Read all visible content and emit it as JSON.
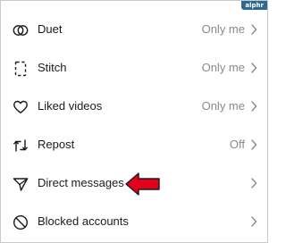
{
  "watermark": "alphr",
  "colors": {
    "accent_arrow": "#e3001b",
    "label": "#1b1b1b",
    "value": "#8a8a8a"
  },
  "rows": [
    {
      "label": "Duet",
      "value": "Only me",
      "icon": "duet-icon"
    },
    {
      "label": "Stitch",
      "value": "Only me",
      "icon": "stitch-icon"
    },
    {
      "label": "Liked videos",
      "value": "Only me",
      "icon": "heart-icon"
    },
    {
      "label": "Repost",
      "value": "Off",
      "icon": "repost-icon"
    },
    {
      "label": "Direct messages",
      "value": "",
      "icon": "send-icon"
    },
    {
      "label": "Blocked accounts",
      "value": "",
      "icon": "block-icon"
    }
  ]
}
